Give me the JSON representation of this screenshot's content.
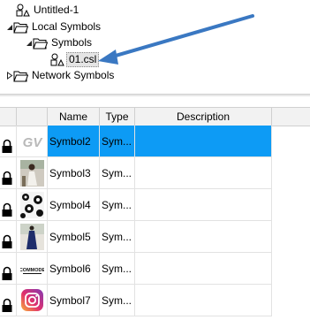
{
  "tree": {
    "root_label": "Untitled-1",
    "local_label": "Local Symbols",
    "symbols_label": "Symbols",
    "file_label": "01.csl",
    "network_label": "Network Symbols"
  },
  "table": {
    "columns": [
      "Name",
      "Type",
      "Description"
    ],
    "rows": [
      {
        "name": "Symbol2",
        "type": "Sym...",
        "description": "",
        "thumb": "gv-logo-icon",
        "selected": true
      },
      {
        "name": "Symbol3",
        "type": "Sym...",
        "description": "",
        "thumb": "person-photo-icon",
        "selected": false
      },
      {
        "name": "Symbol4",
        "type": "Sym...",
        "description": "",
        "thumb": "floral-pattern-icon",
        "selected": false
      },
      {
        "name": "Symbol5",
        "type": "Sym...",
        "description": "",
        "thumb": "dress-photo-icon",
        "selected": false
      },
      {
        "name": "Symbol6",
        "type": "Sym...",
        "description": "",
        "thumb": "text-logo-icon",
        "selected": false
      },
      {
        "name": "Symbol7",
        "type": "Sym...",
        "description": "",
        "thumb": "instagram-icon",
        "selected": false
      }
    ]
  },
  "colors": {
    "selection": "#0d9bf5",
    "arrow": "#3a78c2"
  }
}
